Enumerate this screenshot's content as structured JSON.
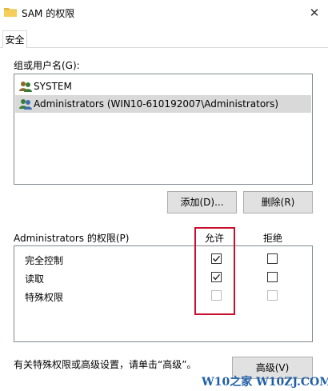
{
  "window": {
    "title": "SAM 的权限"
  },
  "tabs": [
    {
      "label": "安全"
    }
  ],
  "groups": {
    "label": "组或用户名(G):",
    "items": [
      {
        "name": "SYSTEM"
      },
      {
        "name": "Administrators (WIN10-610192007\\Administrators)"
      }
    ],
    "selected_index": 1
  },
  "buttons": {
    "add": "添加(D)...",
    "remove": "删除(R)",
    "advanced": "高级(V)"
  },
  "permissions": {
    "header": "Administrators 的权限(P)",
    "allow_label": "允许",
    "deny_label": "拒绝",
    "rows": [
      {
        "name": "完全控制",
        "allow": true,
        "deny": false,
        "enabled": true
      },
      {
        "name": "读取",
        "allow": true,
        "deny": false,
        "enabled": true
      },
      {
        "name": "特殊权限",
        "allow": false,
        "deny": false,
        "enabled": false
      }
    ]
  },
  "footer": {
    "text": "有关特殊权限或高级设置，请单击“高级”。"
  },
  "watermark": "W10之家 W10ZJ.COM",
  "colors": {
    "highlight": "#c8102e",
    "selected_row": "#d9d9d9",
    "watermark": "#1f5fa8"
  }
}
